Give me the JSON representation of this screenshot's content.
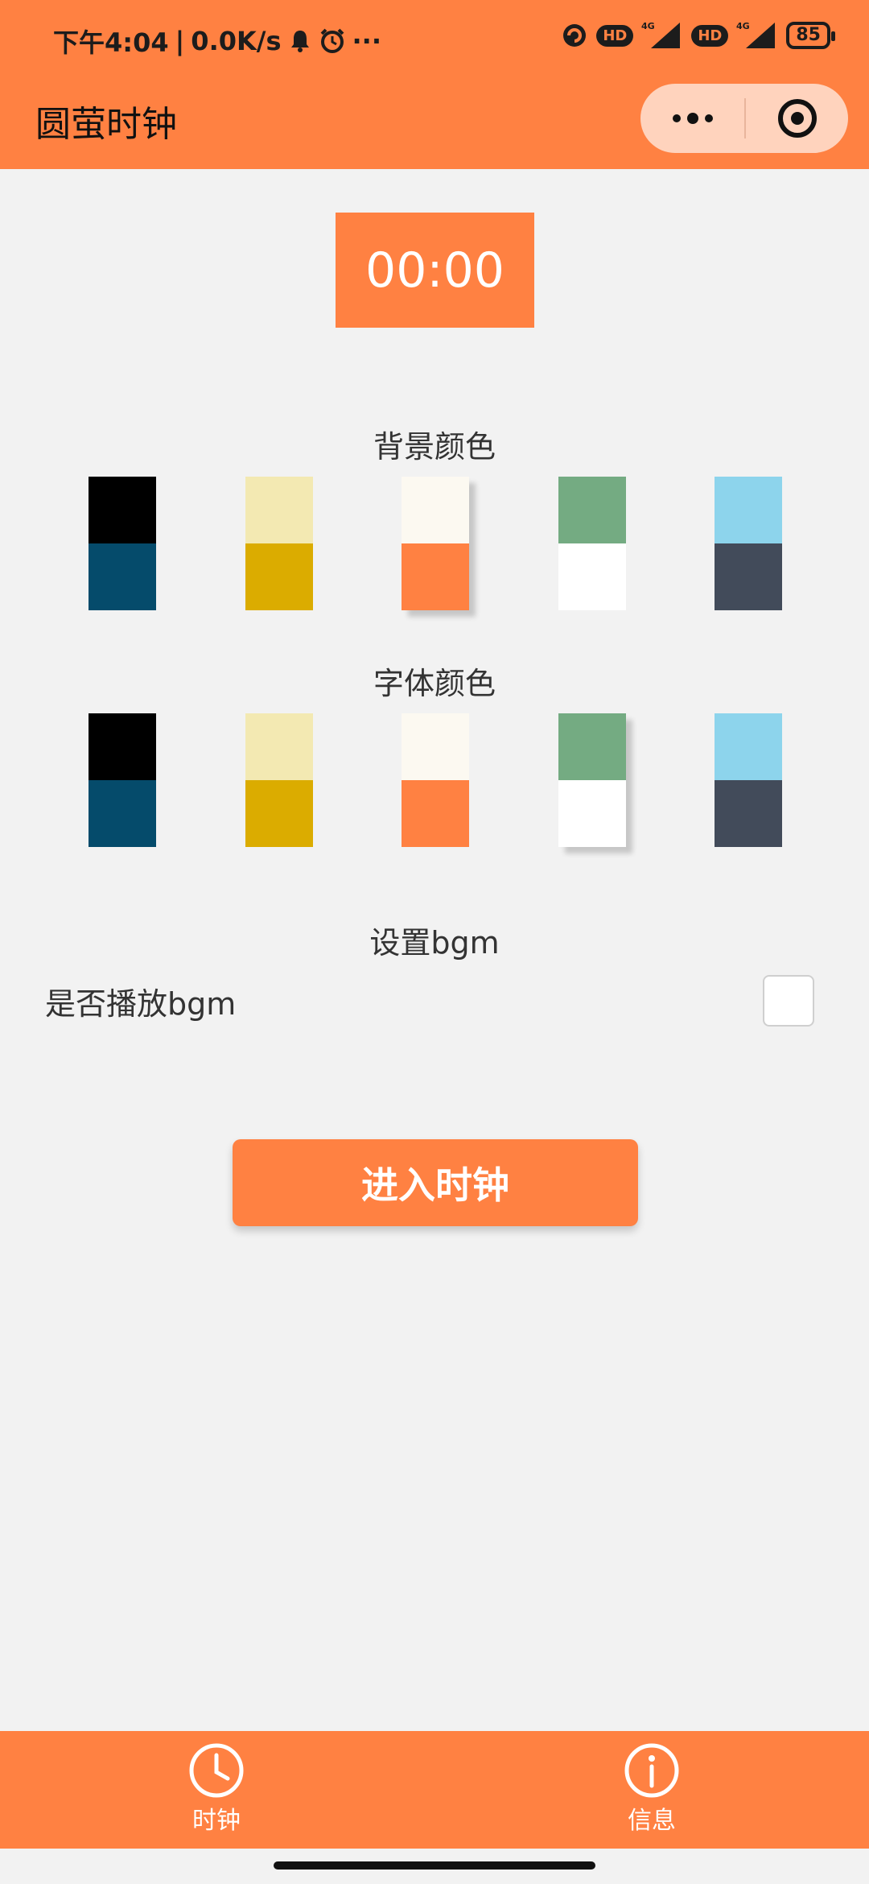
{
  "status_bar": {
    "time": "下午4:04",
    "network_speed": "0.0K/s",
    "more_indicator": "···",
    "hd_label": "HD",
    "signal_label": "4G",
    "battery": "85"
  },
  "nav": {
    "title": "圆萤时钟"
  },
  "preview": {
    "time": "00:00"
  },
  "background_colors": {
    "title": "背景颜色",
    "selected_index": 2,
    "options": [
      {
        "top": "#000000",
        "bottom": "#054b6b"
      },
      {
        "top": "#f3e9b2",
        "bottom": "#dbac00"
      },
      {
        "top": "#fcf9f1",
        "bottom": "#ff8142"
      },
      {
        "top": "#74ab82",
        "bottom": "#ffffff"
      },
      {
        "top": "#8dd4ec",
        "bottom": "#424b5a"
      }
    ]
  },
  "font_colors": {
    "title": "字体颜色",
    "selected_index": 3,
    "options": [
      {
        "top": "#000000",
        "bottom": "#054b6b"
      },
      {
        "top": "#f3e9b2",
        "bottom": "#dbac00"
      },
      {
        "top": "#fcf9f1",
        "bottom": "#ff8142"
      },
      {
        "top": "#74ab82",
        "bottom": "#ffffff"
      },
      {
        "top": "#8dd4ec",
        "bottom": "#424b5a"
      }
    ]
  },
  "bgm": {
    "title": "设置bgm",
    "play_label": "是否播放bgm",
    "checked": false
  },
  "enter_button": {
    "label": "进入时钟"
  },
  "tabbar": {
    "tabs": [
      {
        "label": "时钟",
        "icon": "clock-icon"
      },
      {
        "label": "信息",
        "icon": "info-icon"
      }
    ]
  },
  "colors": {
    "accent": "#ff8142",
    "background": "#f2f2f2"
  }
}
